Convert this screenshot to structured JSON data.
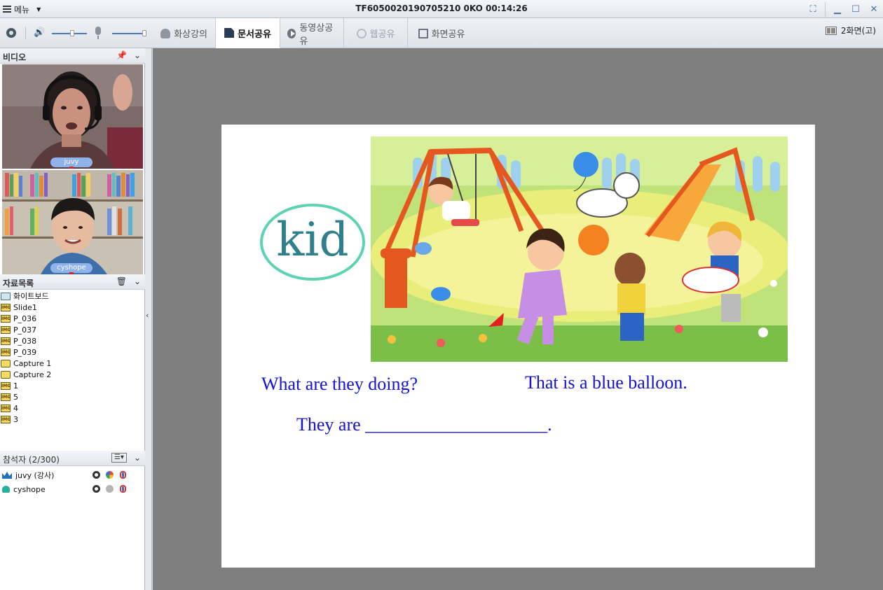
{
  "titlebar": {
    "menu_label": "메뉴",
    "title": "TF6050020190705210 0KO 00:14:26"
  },
  "toolbar": {
    "tabs": [
      {
        "label": "화상강의",
        "icon": "person-icon",
        "state": "normal"
      },
      {
        "label": "문서공유",
        "icon": "document-icon",
        "state": "active"
      },
      {
        "label": "동영상공유",
        "icon": "play-icon",
        "state": "normal"
      },
      {
        "label": "웹공유",
        "icon": "globe-icon",
        "state": "disabled"
      },
      {
        "label": "화면공유",
        "icon": "monitor-icon",
        "state": "normal"
      }
    ],
    "screens_label": "2화면(고)"
  },
  "video": {
    "header": "비디오",
    "participants": [
      {
        "name": "juvy"
      },
      {
        "name": "cyshope"
      }
    ]
  },
  "files": {
    "header": "자료목록",
    "items": [
      {
        "label": "화이트보드",
        "type": "whiteboard"
      },
      {
        "label": "Slide1",
        "type": "img"
      },
      {
        "label": "P_036",
        "type": "img"
      },
      {
        "label": "P_037",
        "type": "img"
      },
      {
        "label": "P_038",
        "type": "img"
      },
      {
        "label": "P_039",
        "type": "img"
      },
      {
        "label": "Capture 1",
        "type": "capture"
      },
      {
        "label": "Capture 2",
        "type": "capture"
      },
      {
        "label": "1",
        "type": "img"
      },
      {
        "label": "5",
        "type": "img"
      },
      {
        "label": "4",
        "type": "img"
      },
      {
        "label": "3",
        "type": "img"
      }
    ],
    "img_badge": "IMG"
  },
  "attendees": {
    "header": "참석자 (2/300)",
    "items": [
      {
        "name": "juvy (강사)",
        "role": "host"
      },
      {
        "name": "cyshope",
        "role": "student"
      }
    ]
  },
  "slide": {
    "vocab_word": "kid",
    "question": "What are they doing?",
    "statement": "That is a blue balloon.",
    "prompt": "They are ____________________."
  },
  "colors": {
    "slide_text": "#1212d8",
    "vocab_word": "#2f7f8c",
    "vocab_oval": "#5ed2b5",
    "stage_bg": "#7f7f7f"
  }
}
